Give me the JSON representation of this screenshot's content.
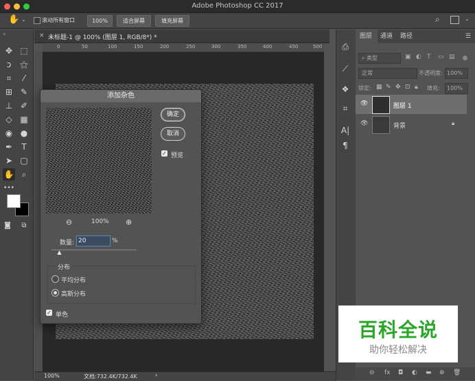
{
  "app": {
    "title": "Adobe Photoshop CC 2017"
  },
  "options": {
    "scroll_all_label": "滚动所有窗口",
    "zoom_btn": "100%",
    "fit_screen": "适合屏幕",
    "fill_screen": "填充屏幕"
  },
  "document": {
    "tab_label": "未标题-1 @ 100% (图层 1, RGB/8*) *"
  },
  "ruler_ticks": [
    "0",
    "50",
    "100",
    "150",
    "200",
    "250",
    "300",
    "350",
    "400",
    "450",
    "500"
  ],
  "status": {
    "zoom": "100%",
    "doc_info": "文档:732.4K/732.4K",
    "arrow": "›"
  },
  "dialog": {
    "title": "添加杂色",
    "ok": "确定",
    "cancel": "取消",
    "preview_label": "预览",
    "zoom_level": "100%",
    "amount_label": "数量:",
    "amount_value": "20",
    "amount_unit": "%",
    "amount_slider_fraction": 0.1,
    "distribution_label": "分布",
    "uniform": "平均分布",
    "gaussian": "高斯分布",
    "mono": "单色"
  },
  "layers_panel": {
    "tabs": [
      "图层",
      "通道",
      "路径"
    ],
    "filter_kind": "类型",
    "blend_mode": "正常",
    "opacity_label": "不透明度:",
    "opacity_value": "100%",
    "lock_label": "锁定:",
    "fill_label": "填充:",
    "fill_value": "100%",
    "layers": [
      {
        "name": "图层 1",
        "selected": true
      },
      {
        "name": "背景",
        "selected": false
      }
    ]
  },
  "watermark": {
    "title": "百科全说",
    "subtitle": "助你轻松解决"
  },
  "colors": {
    "accent_green": "#2aa62a",
    "selected_layer": "#6e6e6e"
  }
}
